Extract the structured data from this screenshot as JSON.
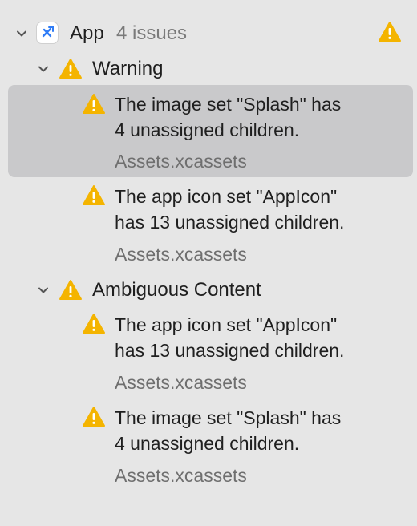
{
  "project": {
    "name": "App",
    "issue_count": "4 issues",
    "icon": "xcode-project-icon"
  },
  "groups": [
    {
      "label": "Warning",
      "issues": [
        {
          "line1": "The image set \"Splash\" has",
          "line2": "4 unassigned children.",
          "file": "Assets.xcassets",
          "selected": true
        },
        {
          "line1": "The app icon set \"AppIcon\"",
          "line2": "has 13 unassigned children.",
          "file": "Assets.xcassets",
          "selected": false
        }
      ]
    },
    {
      "label": "Ambiguous Content",
      "issues": [
        {
          "line1": "The app icon set \"AppIcon\"",
          "line2": "has 13 unassigned children.",
          "file": "Assets.xcassets",
          "selected": false
        },
        {
          "line1": "The image set \"Splash\" has",
          "line2": "4 unassigned children.",
          "file": "Assets.xcassets",
          "selected": false
        }
      ]
    }
  ],
  "colors": {
    "background": "#e6e6e6",
    "selection": "#c9c9cb",
    "warning": "#f4b400"
  }
}
